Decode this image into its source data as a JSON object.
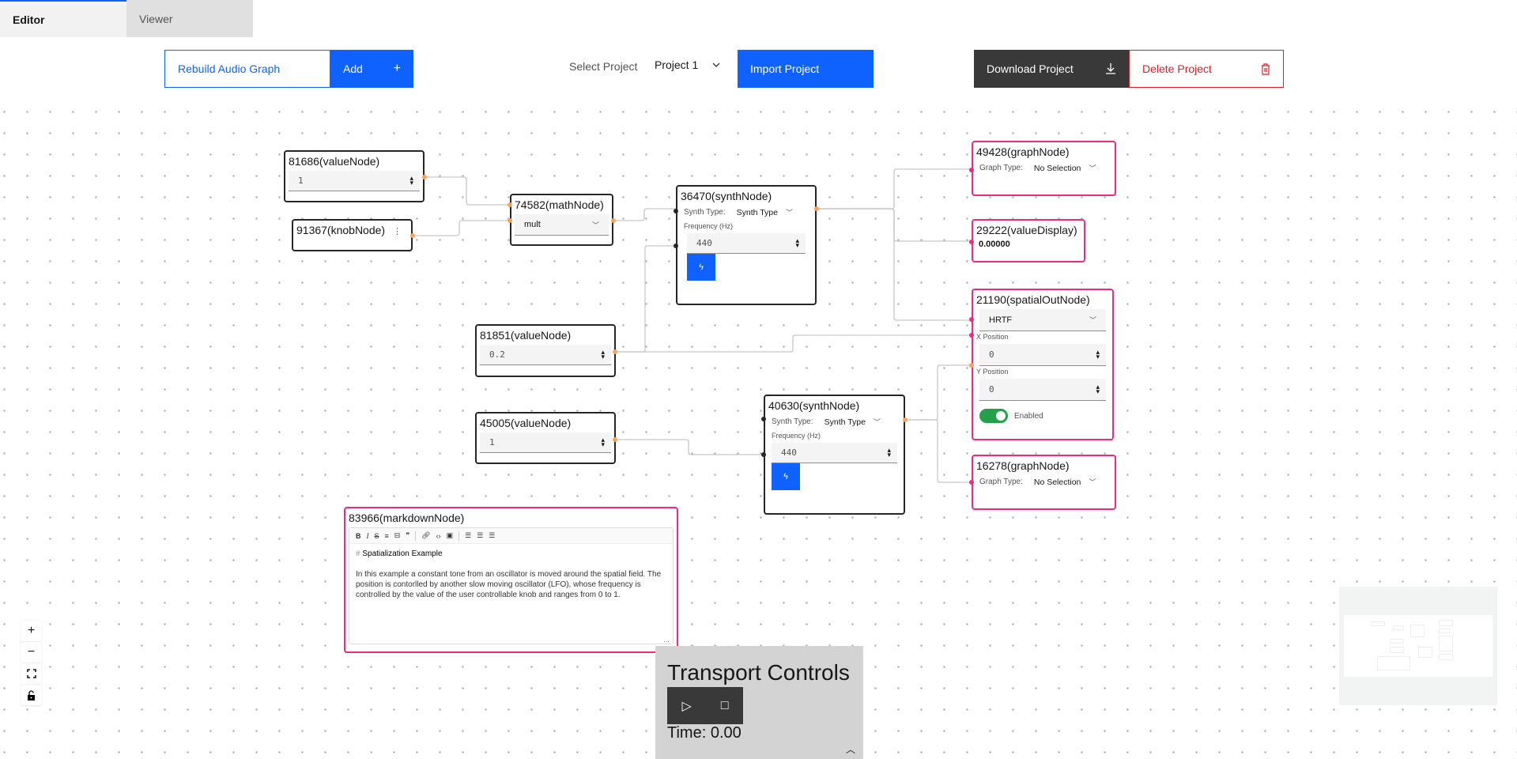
{
  "tabs": [
    {
      "label": "Editor",
      "active": true
    },
    {
      "label": "Viewer",
      "active": false
    }
  ],
  "toolbar": {
    "rebuild_label": "Rebuild Audio Graph",
    "add_label": "Add",
    "add_icon": "+",
    "select_project_label": "Select Project",
    "selected_project": "Project 1",
    "import_label": "Import Project",
    "download_label": "Download Project",
    "delete_label": "Delete Project"
  },
  "colors": {
    "primary": "#0f62fe",
    "danger": "#da1e28",
    "dark": "#393939",
    "node_border": "#262626",
    "output_node_border": "#ee2b7f",
    "port_orange": "#f7a45b",
    "toggle_on": "#24a148"
  },
  "nodes": {
    "n81686": {
      "title": "81686(valueNode)",
      "value": "1"
    },
    "n91367": {
      "title": "91367(knobNode)",
      "menu_icon": "⋮"
    },
    "n74582": {
      "title": "74582(mathNode)",
      "operation": "mult"
    },
    "n36470": {
      "title": "36470(synthNode)",
      "synth_type_label": "Synth Type:",
      "synth_type_value": "Synth Type",
      "freq_label": "Frequency (Hz)",
      "freq_value": "440"
    },
    "n81851": {
      "title": "81851(valueNode)",
      "value": "0.2"
    },
    "n45005": {
      "title": "45005(valueNode)",
      "value": "1"
    },
    "n40630": {
      "title": "40630(synthNode)",
      "synth_type_label": "Synth Type:",
      "synth_type_value": "Synth Type",
      "freq_label": "Frequency (Hz)",
      "freq_value": "440"
    },
    "n49428": {
      "title": "49428(graphNode)",
      "graph_type_label": "Graph Type:",
      "graph_type_value": "No Selection"
    },
    "n29222": {
      "title": "29222(valueDisplay)",
      "value": "0.00000"
    },
    "n21190": {
      "title": "21190(spatialOutNode)",
      "panning_model": "HRTF",
      "x_label": "X Position",
      "x_value": "0",
      "y_label": "Y Position",
      "y_value": "0",
      "enabled_label": "Enabled",
      "enabled": true
    },
    "n16278": {
      "title": "16278(graphNode)",
      "graph_type_label": "Graph Type:",
      "graph_type_value": "No Selection"
    },
    "n83966": {
      "title": "83966(markdownNode)",
      "toolbar": [
        "B",
        "I",
        "S",
        "H",
        "HR",
        "❞",
        "🔗",
        "</>",
        "img",
        "ul",
        "ol",
        "task"
      ],
      "heading_hash": "#",
      "heading": "Spatialization Example",
      "body": "In this example a constant tone from an oscillator is moved around the spatial field. The position is contorlled by another slow moving oscillator (LFO), whose frequency is controlled by the value of the user controllable knob and ranges from 0 to 1."
    }
  },
  "canvas_controls": [
    {
      "name": "zoom-in",
      "glyph": "+"
    },
    {
      "name": "zoom-out",
      "glyph": "−"
    },
    {
      "name": "fit-view",
      "glyph": "⛶"
    },
    {
      "name": "lock",
      "glyph": "🔒"
    }
  ],
  "transport": {
    "title": "Transport Controls",
    "play_icon": "▷",
    "stop_icon": "□",
    "time": "Time: 0.00",
    "collapse_icon": "︿"
  }
}
